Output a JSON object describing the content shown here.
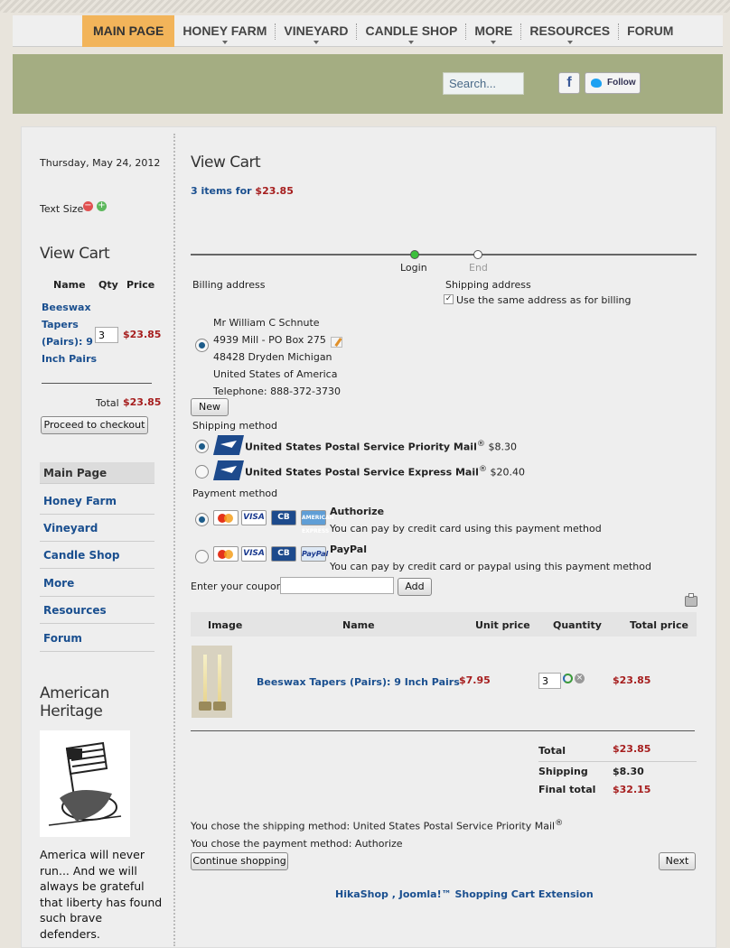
{
  "nav": {
    "items": [
      {
        "label": "MAIN PAGE",
        "active": true
      },
      {
        "label": "HONEY FARM"
      },
      {
        "label": "VINEYARD"
      },
      {
        "label": "CANDLE SHOP"
      },
      {
        "label": "MORE"
      },
      {
        "label": "RESOURCES"
      },
      {
        "label": "FORUM"
      }
    ]
  },
  "header": {
    "search_placeholder": "Search...",
    "facebook_label": "f",
    "follow_label": "Follow"
  },
  "sidebar": {
    "date": "Thursday, May 24, 2012",
    "text_size_label": "Text Size",
    "cart_title": "View Cart",
    "cart_headers": {
      "name": "Name",
      "qty": "Qty",
      "price": "Price"
    },
    "cart_item": {
      "name_line1": "Beeswax",
      "name_line2": "Tapers",
      "name_line3": "(Pairs): 9",
      "name_line4": "Inch Pairs",
      "qty": "3",
      "price": "$23.85"
    },
    "total_label": "Total",
    "total_value": "$23.85",
    "checkout_button": "Proceed to checkout",
    "menu": [
      {
        "label": "Main Page",
        "active": true
      },
      {
        "label": "Honey Farm"
      },
      {
        "label": "Vineyard"
      },
      {
        "label": "Candle Shop"
      },
      {
        "label": "More"
      },
      {
        "label": "Resources"
      },
      {
        "label": "Forum"
      }
    ],
    "heritage_title_1": "American",
    "heritage_title_2": "Heritage",
    "heritage_text_1": "America will never",
    "heritage_text_2": "run... And we will",
    "heritage_text_3": "always be grateful",
    "heritage_text_4": "that liberty has found",
    "heritage_text_5": "such brave",
    "heritage_text_6": "defenders."
  },
  "content": {
    "title": "View Cart",
    "summary_prefix": "3 items for ",
    "summary_amount": "$23.85",
    "steps": {
      "login": "Login",
      "end": "End"
    },
    "billing_label": "Billing address",
    "shipping_address_label": "Shipping address",
    "same_address_label": "Use the same address as for billing",
    "address": {
      "name": "Mr William C Schnute",
      "line1": "4939 Mill - PO Box 275",
      "line2": "48428 Dryden Michigan",
      "country": "United States of America",
      "phone": "Telephone: 888-372-3730"
    },
    "new_button": "New",
    "shipping_method_label": "Shipping method",
    "shipping_methods": [
      {
        "name": "United States Postal Service Priority Mail",
        "reg": "®",
        "price": "$8.30",
        "selected": true
      },
      {
        "name": "United States Postal Service Express Mail",
        "reg": "®",
        "price": "$20.40",
        "selected": false
      }
    ],
    "payment_method_label": "Payment method",
    "payment_methods": [
      {
        "name": "Authorize",
        "desc": "You can pay by credit card using this payment method",
        "selected": true
      },
      {
        "name": "PayPal",
        "desc": "You can pay by credit card or paypal using this payment method",
        "selected": false
      }
    ],
    "card_labels": {
      "visa": "VISA",
      "cb": "CB",
      "amex": "AMERICAN EXPRESS",
      "paypal": "PayPal"
    },
    "coupon_label": "Enter your coupon",
    "add_button": "Add",
    "table_headers": {
      "image": "Image",
      "name": "Name",
      "unit_price": "Unit price",
      "quantity": "Quantity",
      "total_price": "Total price"
    },
    "row": {
      "name": "Beeswax Tapers (Pairs): 9 Inch Pairs",
      "unit_price": "$7.95",
      "quantity": "3",
      "total_price": "$23.85"
    },
    "totals": [
      {
        "label": "Total",
        "value": "$23.85"
      },
      {
        "label": "Shipping",
        "value": "$8.30"
      },
      {
        "label": "Final total",
        "value": "$32.15"
      }
    ],
    "chose_shipping": "You chose the shipping method: United States Postal Service Priority Mail",
    "chose_shipping_reg": "®",
    "chose_payment": "You chose the payment method: Authorize",
    "continue_button": "Continue shopping",
    "next_button": "Next",
    "footer_link": "HikaShop , Joomla!™ Shopping Cart Extension"
  },
  "colors": {
    "accent_nav": "#f2b45a",
    "band": "#a4ad82",
    "link": "#1a4f8f",
    "price": "#a61e1e"
  }
}
